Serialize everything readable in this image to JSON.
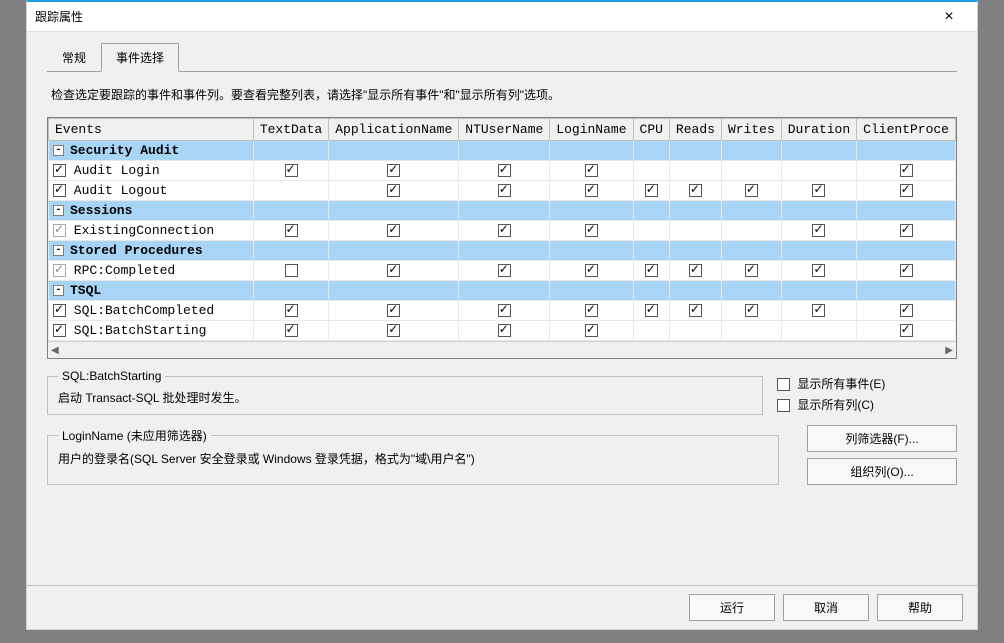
{
  "window": {
    "title": "跟踪属性"
  },
  "tabs": {
    "general": "常规",
    "events": "事件选择"
  },
  "instruction": "检查选定要跟踪的事件和事件列。要查看完整列表，请选择\"显示所有事件\"和\"显示所有列\"选项。",
  "columns": {
    "events": "Events",
    "c1": "TextData",
    "c2": "ApplicationName",
    "c3": "NTUserName",
    "c4": "LoginName",
    "c5": "CPU",
    "c6": "Reads",
    "c7": "Writes",
    "c8": "Duration",
    "c9": "ClientProce"
  },
  "rows": [
    {
      "type": "cat",
      "label": "Security Audit"
    },
    {
      "type": "leaf",
      "label": "Audit Login",
      "cb": true,
      "cells": [
        true,
        true,
        true,
        true,
        null,
        null,
        null,
        null,
        true
      ]
    },
    {
      "type": "leaf",
      "label": "Audit Logout",
      "cb": true,
      "cells": [
        null,
        true,
        true,
        true,
        true,
        true,
        true,
        true,
        true
      ]
    },
    {
      "type": "cat",
      "label": "Sessions"
    },
    {
      "type": "leaf",
      "label": "ExistingConnection",
      "cb": "dis",
      "cells": [
        true,
        true,
        true,
        true,
        null,
        null,
        null,
        true,
        true
      ]
    },
    {
      "type": "cat",
      "label": "Stored Procedures"
    },
    {
      "type": "leaf",
      "label": "RPC:Completed",
      "cb": "dis",
      "cells": [
        false,
        true,
        true,
        true,
        true,
        true,
        true,
        true,
        true
      ]
    },
    {
      "type": "cat",
      "label": "TSQL"
    },
    {
      "type": "leaf",
      "label": "SQL:BatchCompleted",
      "cb": true,
      "cells": [
        true,
        true,
        true,
        true,
        true,
        true,
        true,
        true,
        true
      ]
    },
    {
      "type": "leaf",
      "label": "SQL:BatchStarting",
      "cb": true,
      "cells": [
        true,
        true,
        true,
        true,
        null,
        null,
        null,
        null,
        true
      ]
    }
  ],
  "info1": {
    "legend": "SQL:BatchStarting",
    "text": "启动 Transact-SQL 批处理时发生。"
  },
  "info2": {
    "legend": "LoginName (未应用筛选器)",
    "text": "用户的登录名(SQL Server 安全登录或 Windows 登录凭据，格式为\"域\\用户名\")"
  },
  "opts": {
    "show_events": "显示所有事件(E)",
    "show_cols": "显示所有列(C)"
  },
  "buttons": {
    "col_filter": "列筛选器(F)...",
    "organize": "组织列(O)...",
    "run": "运行",
    "cancel": "取消",
    "help": "帮助"
  }
}
